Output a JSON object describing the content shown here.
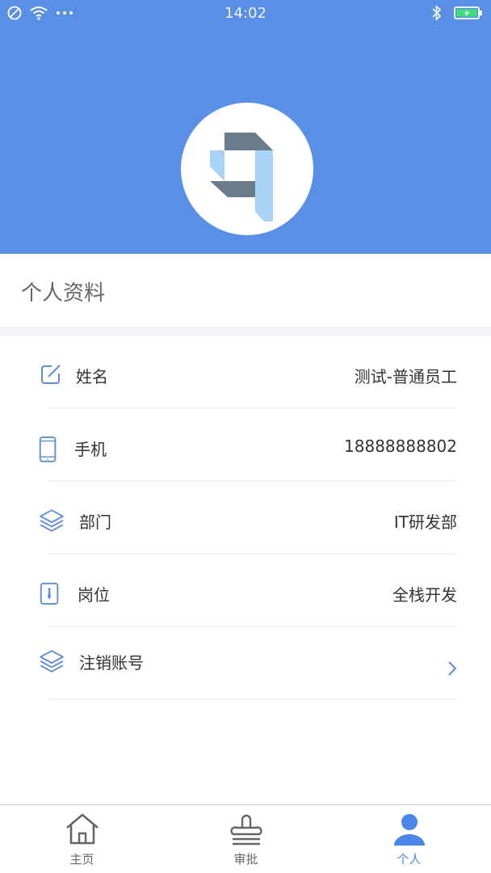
{
  "status_bar": {
    "time": "14:02"
  },
  "profile": {
    "section_title": "个人资料"
  },
  "rows": [
    {
      "label": "姓名",
      "value": "测试-普通员工",
      "icon": "edit-icon"
    },
    {
      "label": "手机",
      "value": "18888888802",
      "icon": "phone-icon"
    },
    {
      "label": "部门",
      "value": "IT研发部",
      "icon": "layers-icon"
    },
    {
      "label": "岗位",
      "value": "全栈开发",
      "icon": "badge-icon"
    },
    {
      "label": "注销账号",
      "value": "",
      "icon": "layers-icon"
    }
  ],
  "tabs": [
    {
      "label": "主页",
      "icon": "home-icon"
    },
    {
      "label": "审批",
      "icon": "stamp-icon"
    },
    {
      "label": "个人",
      "icon": "person-icon"
    }
  ],
  "colors": {
    "header_bg": "#5a8fe6",
    "accent": "#4a86e8",
    "icon_blue": "#5b8ed6"
  }
}
